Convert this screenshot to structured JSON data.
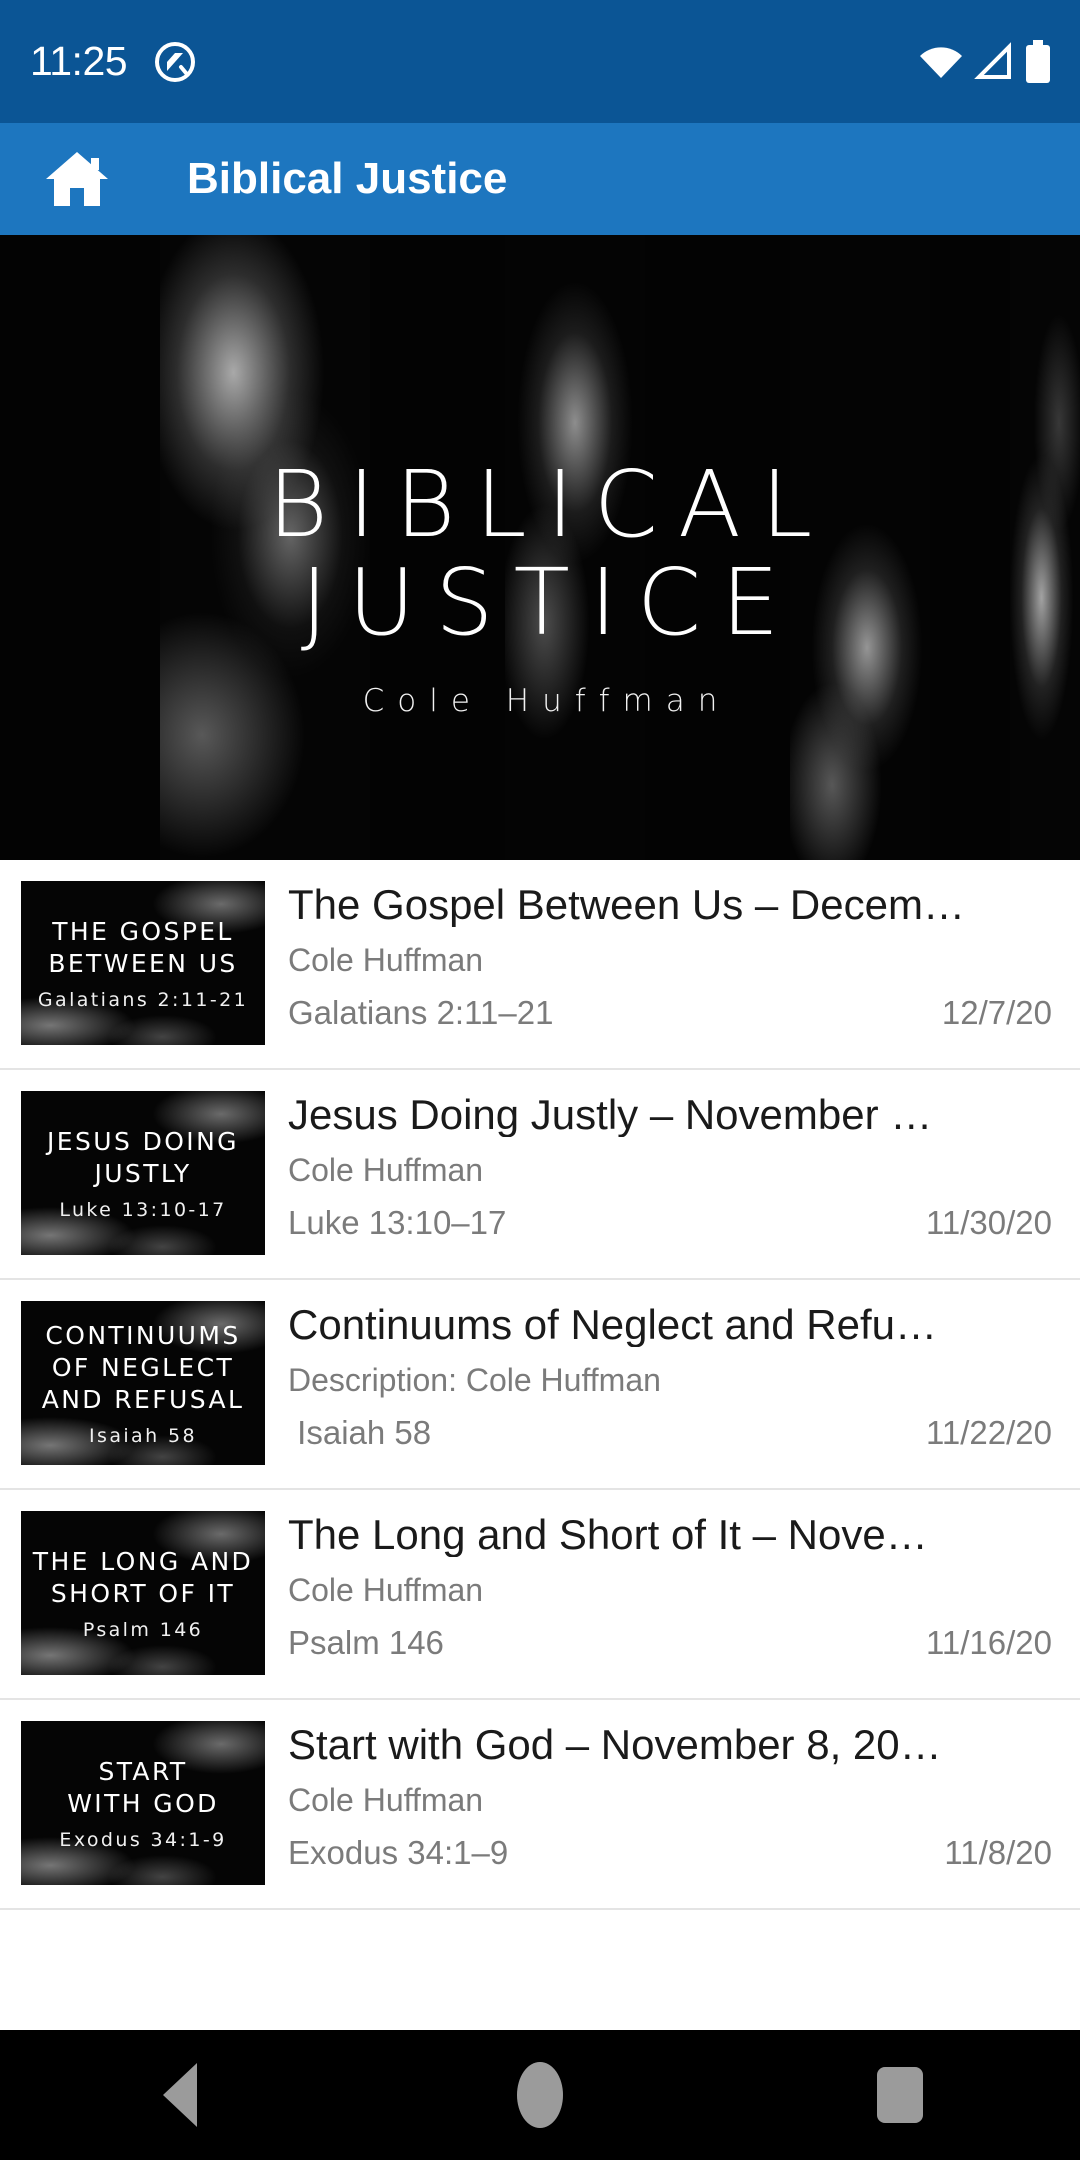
{
  "status_bar": {
    "time": "11:25",
    "background_color": "#0b5595",
    "icons": [
      "notification-circle-icon",
      "wifi-icon",
      "cellular-signal-icon",
      "battery-icon"
    ]
  },
  "app_bar": {
    "title": "Biblical Justice",
    "home_icon": "home-icon",
    "background_color": "#1d76bf"
  },
  "hero": {
    "title_line1": "BIBLICAL",
    "title_line2": "JUSTICE",
    "subtitle": "Cole Huffman"
  },
  "sermons": [
    {
      "thumb_title": "THE GOSPEL\nBETWEEN US",
      "thumb_ref": "Galatians 2:11-21",
      "title": "The Gospel Between Us – Decem…",
      "speaker": "Cole Huffman",
      "scripture": "Galatians 2:11–21",
      "date": "12/7/20"
    },
    {
      "thumb_title": "JESUS DOING\nJUSTLY",
      "thumb_ref": "Luke 13:10-17",
      "title": "Jesus Doing Justly – November …",
      "speaker": "Cole Huffman",
      "scripture": "Luke 13:10–17",
      "date": "11/30/20"
    },
    {
      "thumb_title": "CONTINUUMS\nOF NEGLECT\nAND REFUSAL",
      "thumb_ref": "Isaiah 58",
      "title": "Continuums of Neglect and Refu…",
      "speaker": "Description: Cole Huffman",
      "scripture": " Isaiah 58",
      "date": "11/22/20"
    },
    {
      "thumb_title": "THE LONG AND\nSHORT OF IT",
      "thumb_ref": "Psalm 146",
      "title": "The Long and Short of It – Nove…",
      "speaker": "Cole Huffman",
      "scripture": "Psalm 146",
      "date": "11/16/20"
    },
    {
      "thumb_title": "START\nWITH GOD",
      "thumb_ref": "Exodus 34:1-9",
      "title": "Start with God – November 8, 20…",
      "speaker": "Cole Huffman",
      "scripture": "Exodus 34:1–9",
      "date": "11/8/20"
    }
  ],
  "nav_bar": {
    "back": "back-button",
    "home": "home-button",
    "recents": "recents-button"
  }
}
